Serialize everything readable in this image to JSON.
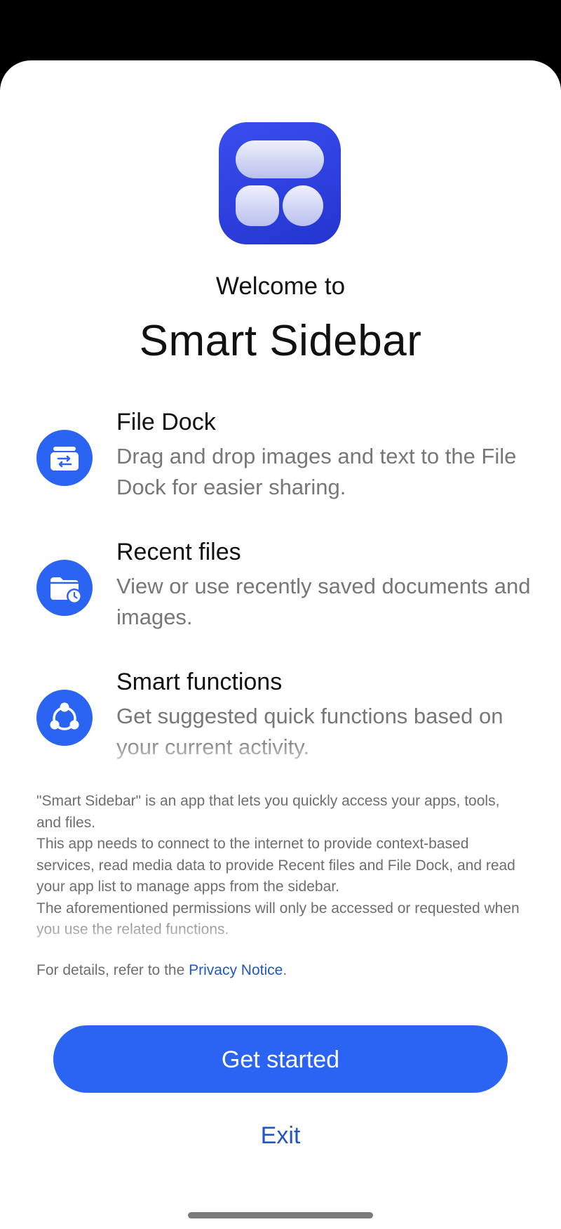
{
  "header": {
    "welcome": "Welcome to",
    "title": "Smart Sidebar"
  },
  "features": [
    {
      "icon": "file-dock-icon",
      "title": "File Dock",
      "description": "Drag and drop images and text to the File Dock for easier sharing."
    },
    {
      "icon": "recent-files-icon",
      "title": "Recent files",
      "description": "View or use recently saved documents and images."
    },
    {
      "icon": "smart-functions-icon",
      "title": "Smart functions",
      "description": "Get suggested quick functions based on your current activity."
    }
  ],
  "info": {
    "paragraph1": "\"Smart Sidebar\" is an app that lets you quickly access your apps, tools, and files.",
    "paragraph2": "This app needs to connect to the internet to provide context-based services, read media data to provide Recent files and File Dock, and read your app list to manage apps from the sidebar.",
    "paragraph3": "The aforementioned permissions will only be accessed or requested when you use the related functions.",
    "privacy_prefix": "For details, refer to the ",
    "privacy_link": "Privacy Notice",
    "privacy_suffix": "."
  },
  "actions": {
    "get_started": "Get started",
    "exit": "Exit"
  },
  "colors": {
    "accent": "#2b64f2",
    "link": "#1f56c8",
    "app_icon": "#2f42e0"
  }
}
